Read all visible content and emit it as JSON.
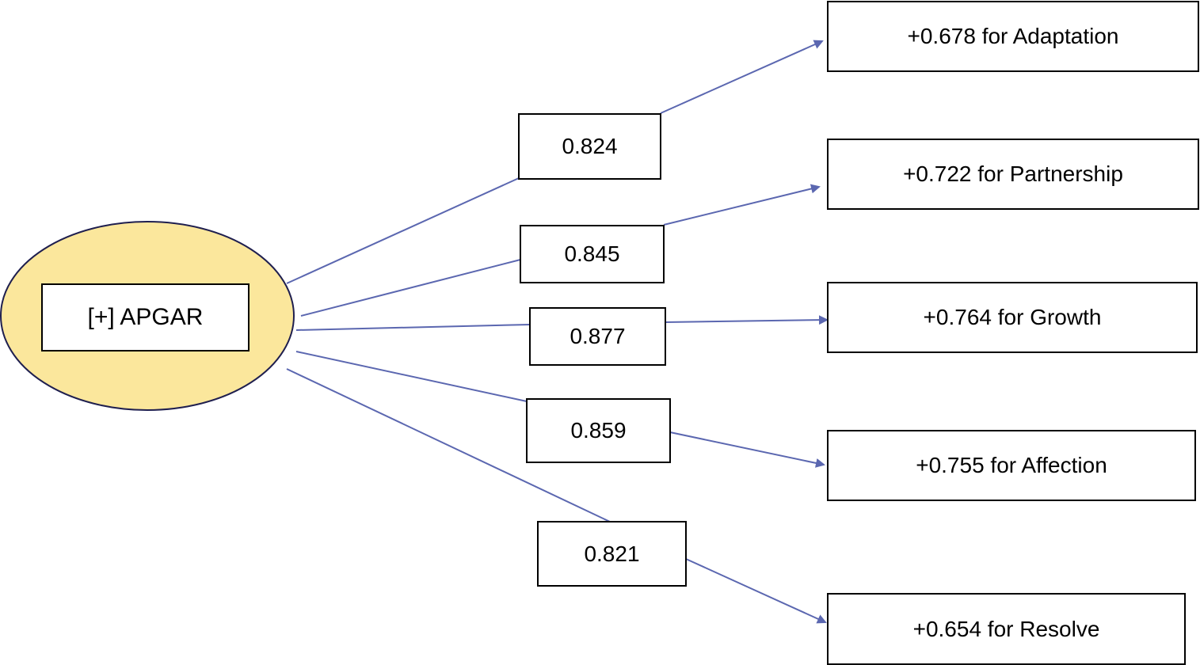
{
  "diagram": {
    "root": {
      "label": "[+] APGAR",
      "fill": "#fbe79c",
      "stroke": "#1f1f4f"
    },
    "edge_color": "#5b67b0",
    "branches": [
      {
        "loading": "0.824",
        "target": "+0.678 for Adaptation"
      },
      {
        "loading": "0.845",
        "target": "+0.722 for Partnership"
      },
      {
        "loading": "0.877",
        "target": "+0.764 for Growth"
      },
      {
        "loading": "0.859",
        "target": "+0.755 for Affection"
      },
      {
        "loading": "0.821",
        "target": "+0.654 for Resolve"
      }
    ]
  }
}
